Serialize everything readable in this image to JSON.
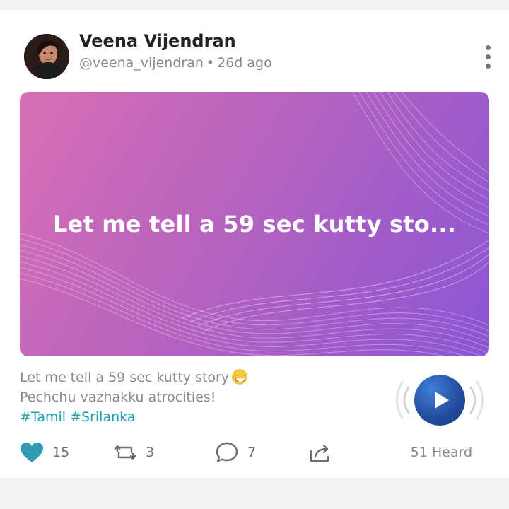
{
  "post": {
    "author_name": "Veena Vijendran",
    "handle": "@veena_vijendran",
    "separator": "•",
    "time_ago": "26d ago",
    "banner_title": "Let me tell a 59 sec kutty sto...",
    "description_line1": "Let me tell a 59 sec kutty story",
    "description_line2": "Pechchu vazhakku atrocities!",
    "hashtags": [
      "#Tamil",
      "#Srilanka"
    ],
    "emoji": "grinning-face-emoji"
  },
  "actions": {
    "likes": "15",
    "reposts": "3",
    "comments": "7",
    "heard": "51 Heard"
  },
  "colors": {
    "banner_start": "#d86fb4",
    "banner_end": "#8b55d4",
    "heart": "#2f9cb4",
    "hashtag": "#1f9fb0",
    "play_button": "#234a9c"
  },
  "icons": {
    "menu": "more-vertical-icon",
    "play": "play-icon",
    "like": "heart-icon",
    "repost": "repost-icon",
    "comment": "comment-icon",
    "share": "share-icon"
  }
}
